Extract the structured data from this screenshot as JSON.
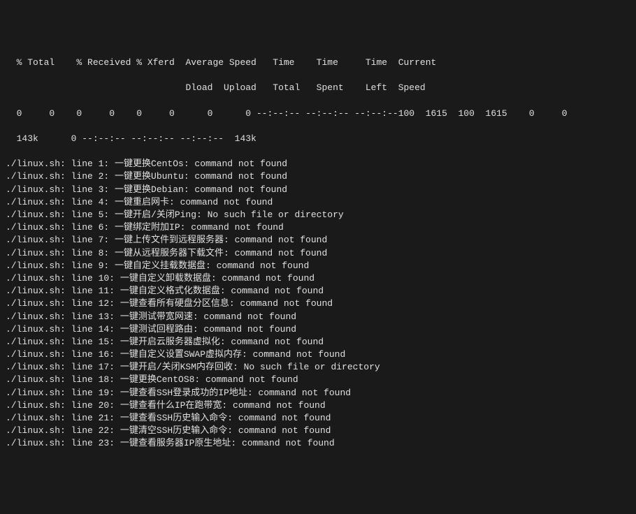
{
  "header": {
    "line1": "  % Total    % Received % Xferd  Average Speed   Time    Time     Time  Current",
    "line2": "                                 Dload  Upload   Total   Spent    Left  Speed",
    "line3": "  0     0    0     0    0     0      0      0 --:--:-- --:--:-- --:--:--100  1615  100  1615    0     0",
    "line4": "  143k      0 --:--:-- --:--:-- --:--:--  143k"
  },
  "errors": [
    {
      "script": "./linux.sh",
      "line": "1",
      "cmd": "一键更换CentOs",
      "msg": "command not found"
    },
    {
      "script": "./linux.sh",
      "line": "2",
      "cmd": "一键更换Ubuntu",
      "msg": "command not found"
    },
    {
      "script": "./linux.sh",
      "line": "3",
      "cmd": "一键更换Debian",
      "msg": "command not found"
    },
    {
      "script": "./linux.sh",
      "line": "4",
      "cmd": "一键重启网卡",
      "msg": "command not found"
    },
    {
      "script": "./linux.sh",
      "line": "5",
      "cmd": "一键开启/关闭Ping",
      "msg": "No such file or directory"
    },
    {
      "script": "./linux.sh",
      "line": "6",
      "cmd": "一键绑定附加IP",
      "msg": "command not found"
    },
    {
      "script": "./linux.sh",
      "line": "7",
      "cmd": "一键上传文件到远程服务器",
      "msg": "command not found"
    },
    {
      "script": "./linux.sh",
      "line": "8",
      "cmd": "一键从远程服务器下载文件",
      "msg": "command not found"
    },
    {
      "script": "./linux.sh",
      "line": "9",
      "cmd": "一键自定义挂载数据盘",
      "msg": "command not found"
    },
    {
      "script": "./linux.sh",
      "line": "10",
      "cmd": "一键自定义卸载数据盘",
      "msg": "command not found"
    },
    {
      "script": "./linux.sh",
      "line": "11",
      "cmd": "一键自定义格式化数据盘",
      "msg": "command not found"
    },
    {
      "script": "./linux.sh",
      "line": "12",
      "cmd": "一键查看所有硬盘分区信息",
      "msg": "command not found"
    },
    {
      "script": "./linux.sh",
      "line": "13",
      "cmd": "一键测试带宽网速",
      "msg": "command not found"
    },
    {
      "script": "./linux.sh",
      "line": "14",
      "cmd": "一键测试回程路由",
      "msg": "command not found"
    },
    {
      "script": "./linux.sh",
      "line": "15",
      "cmd": "一键开启云服务器虚拟化",
      "msg": "command not found"
    },
    {
      "script": "./linux.sh",
      "line": "16",
      "cmd": "一键自定义设置SWAP虚拟内存",
      "msg": "command not found"
    },
    {
      "script": "./linux.sh",
      "line": "17",
      "cmd": "一键开启/关闭KSM内存回收",
      "msg": "No such file or directory"
    },
    {
      "script": "./linux.sh",
      "line": "18",
      "cmd": "一键更换CentOS8",
      "msg": "command not found"
    },
    {
      "script": "./linux.sh",
      "line": "19",
      "cmd": "一键查看SSH登录成功的IP地址",
      "msg": "command not found"
    },
    {
      "script": "./linux.sh",
      "line": "20",
      "cmd": "一键查看什么IP在跑带宽",
      "msg": "command not found"
    },
    {
      "script": "./linux.sh",
      "line": "21",
      "cmd": "一键查看SSH历史输入命令",
      "msg": "command not found"
    },
    {
      "script": "./linux.sh",
      "line": "22",
      "cmd": "一键清空SSH历史输入命令",
      "msg": "command not found"
    },
    {
      "script": "./linux.sh",
      "line": "23",
      "cmd": "一键查看服务器IP原生地址",
      "msg": "command not found"
    }
  ]
}
